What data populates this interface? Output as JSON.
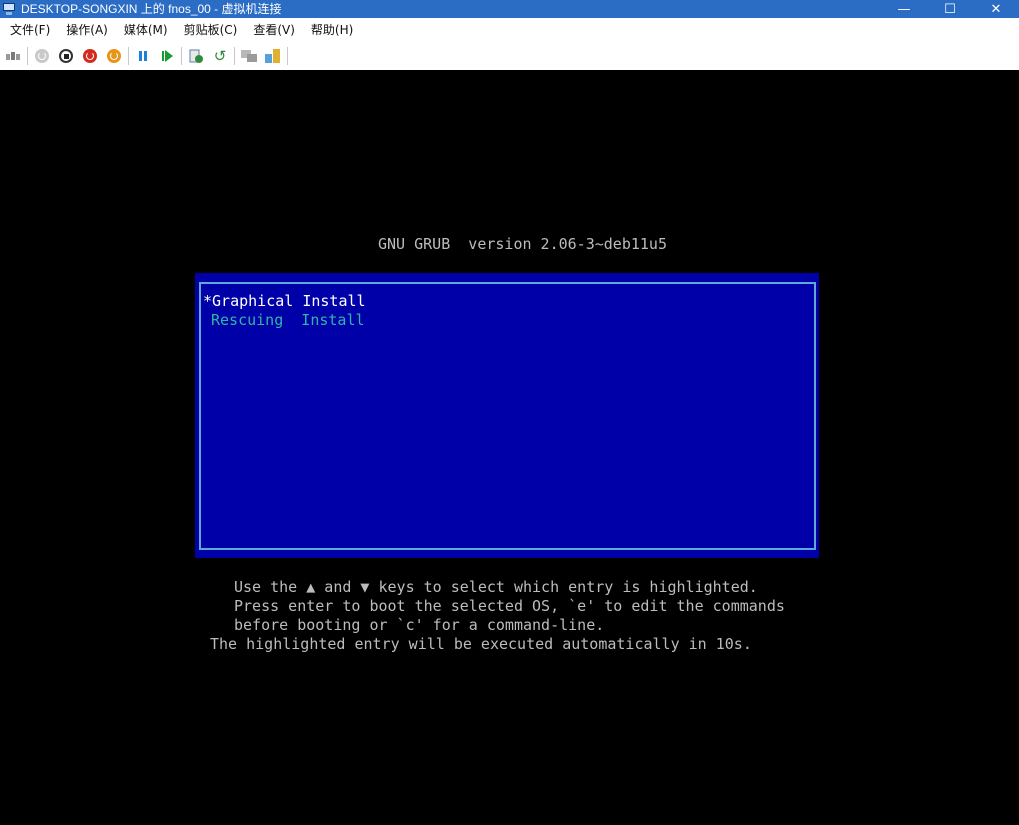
{
  "window": {
    "title": "DESKTOP-SONGXIN 上的 fnos_00 - 虚拟机连接",
    "minimize": "—",
    "maximize": "☐",
    "close": "✕"
  },
  "menubar": {
    "items": [
      "文件(F)",
      "操作(A)",
      "媒体(M)",
      "剪贴板(C)",
      "查看(V)",
      "帮助(H)"
    ]
  },
  "toolbar": {
    "icons": [
      "ctrl-alt-del-icon",
      "start-icon",
      "turn-off-icon",
      "shut-down-icon",
      "save-icon",
      "pause-icon",
      "resume-icon",
      "checkpoint-icon",
      "revert-icon",
      "enhanced-session-icon",
      "zoom-icon"
    ]
  },
  "grub": {
    "title": "GNU GRUB  version 2.06-3~deb11u5",
    "entries": [
      "*Graphical Install",
      "Rescuing  Install"
    ],
    "help": [
      "Use the ▲ and ▼ keys to select which entry is highlighted.",
      "Press enter to boot the selected OS, `e' to edit the commands",
      "before booting or `c' for a command-line.",
      "The highlighted entry will be executed automatically in 10s."
    ]
  },
  "colors": {
    "titlebar": "#2b6cc4",
    "menu_bg": "#0000a8",
    "menu_border": "#5ea9d6",
    "selected_text": "#ffffff",
    "unselected_text": "#2eb5a8",
    "console_text": "#bcbcbc"
  }
}
